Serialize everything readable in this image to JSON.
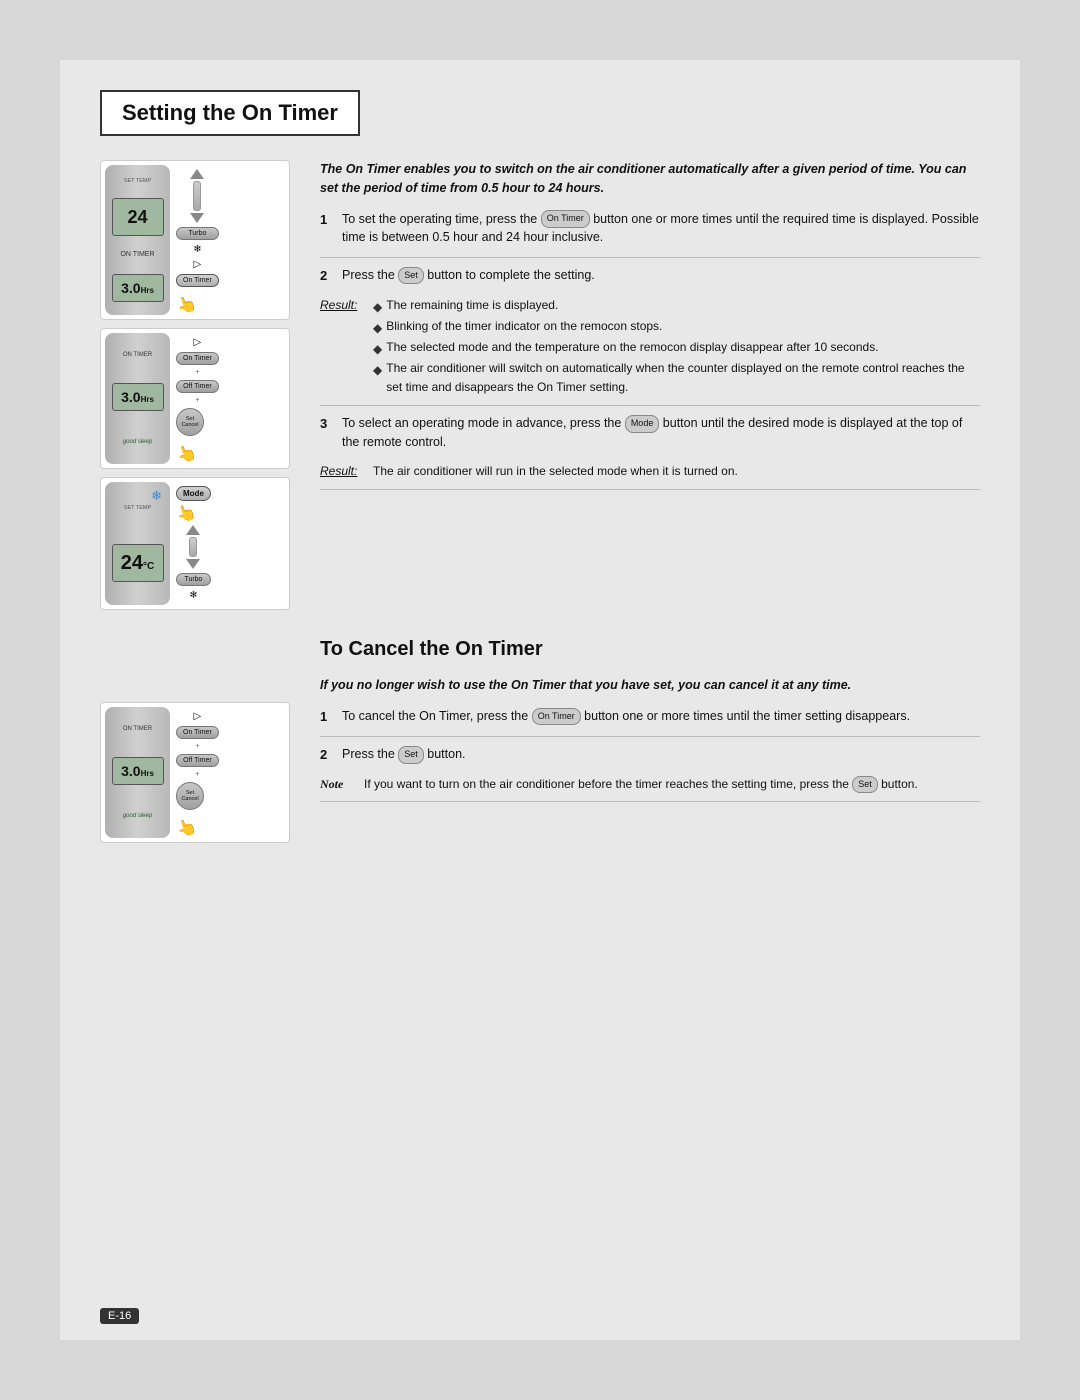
{
  "page": {
    "background_color": "#d8d8d8",
    "page_number": "E-16"
  },
  "section1": {
    "title": "Setting the On Timer",
    "intro": "The On Timer enables you to switch on the air conditioner automatically after a given period of time. You can set the period of time from 0.5 hour to 24 hours.",
    "steps": [
      {
        "num": "1",
        "text": "To set the operating time, press the",
        "btn": "On Timer",
        "text2": "button one or more times until the required time is displayed. Possible time is between 0.5 hour and 24 hour inclusive."
      },
      {
        "num": "2",
        "text": "Press the",
        "btn": "Set",
        "text2": "button to complete the setting."
      },
      {
        "num": "3",
        "text": "To select an operating mode in advance, press the",
        "btn": "Mode",
        "text2": "button until the desired mode is displayed at the top of the remote control."
      }
    ],
    "result1": {
      "label": "Result:",
      "items": [
        "The remaining time is displayed.",
        "Blinking of the timer indicator on the remocon stops.",
        "The selected mode and the temperature on the remocon display disappear after 10 seconds.",
        "The air conditioner will switch on automatically when the counter displayed on the remote control reaches the set time and disappears the On Timer setting."
      ]
    },
    "result2": {
      "label": "Result:",
      "text": "The air conditioner will run in the selected mode when it is turned on."
    }
  },
  "section2": {
    "title": "To Cancel the On Timer",
    "intro": "If you no longer wish to use the On Timer that you have set, you can cancel it at any time.",
    "steps": [
      {
        "num": "1",
        "text": "To cancel the On Timer, press the",
        "btn": "On Timer",
        "text2": "button one or more times until the timer setting disappears."
      },
      {
        "num": "2",
        "text": "Press the",
        "btn": "Set",
        "text2": "button."
      }
    ],
    "note": {
      "label": "Note",
      "text": "If you want to turn on the air conditioner before the timer reaches the setting time, press the",
      "btn": "Set",
      "text2": "button."
    }
  },
  "remotes": {
    "r1": {
      "temp": "24",
      "timer": "3.0",
      "timer_unit": "Hrs",
      "show_ontimer": true
    },
    "r2": {
      "timer": "3.0",
      "timer_unit": "Hrs",
      "show_ontimer": true,
      "show_offtimer": true,
      "good_sleep": true
    },
    "r3": {
      "temp": "24",
      "temp_unit": "°C",
      "show_mode": true,
      "show_snowflake": true
    },
    "r4": {
      "timer": "3.0",
      "show_ontimer": true,
      "show_offtimer": true,
      "good_sleep": true
    }
  }
}
